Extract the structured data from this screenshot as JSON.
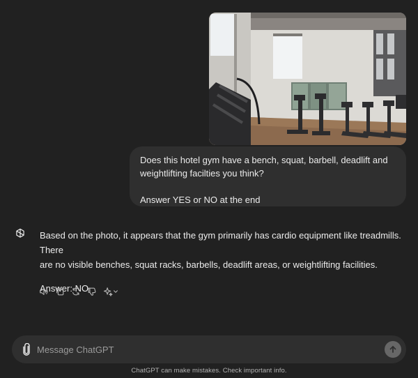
{
  "conversation": {
    "user_message": {
      "line1": "Does this hotel gym have a bench, squat, barbell, deadlift and",
      "line2": "weightlifting facilties you think?",
      "line3": "Answer YES or NO at the end"
    },
    "assistant_message": {
      "line1": "Based on the photo, it appears that the gym primarily has cardio equipment like treadmills. There",
      "line2": "are no visible benches, squat racks, barbells, deadlift areas, or weightlifting facilities.",
      "answer": "Answer: NO"
    },
    "action_icons": [
      "speaker-icon",
      "copy-icon",
      "regenerate-icon",
      "thumbs-down-icon",
      "sparkle-model-icon",
      "chevron-down-icon"
    ]
  },
  "composer": {
    "placeholder": "Message ChatGPT",
    "value": ""
  },
  "footer": {
    "disclaimer": "ChatGPT can make mistakes. Check important info."
  },
  "colors": {
    "background": "#212121",
    "bubble": "#2f2f2f",
    "text": "#ececec",
    "muted": "#9b9b9b",
    "send_button": "#676767"
  }
}
